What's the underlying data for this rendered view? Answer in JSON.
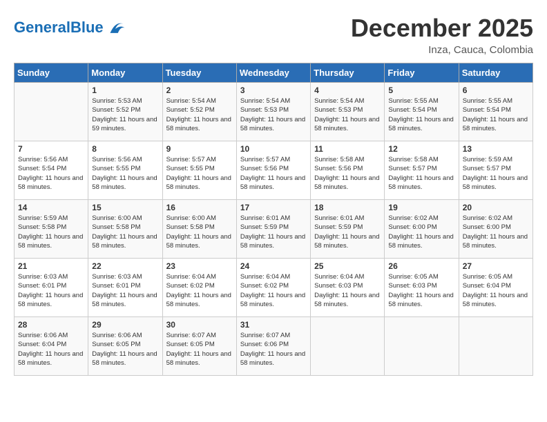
{
  "header": {
    "logo_general": "General",
    "logo_blue": "Blue",
    "title": "December 2025",
    "subtitle": "Inza, Cauca, Colombia"
  },
  "calendar": {
    "days_of_week": [
      "Sunday",
      "Monday",
      "Tuesday",
      "Wednesday",
      "Thursday",
      "Friday",
      "Saturday"
    ],
    "weeks": [
      [
        {
          "day": "",
          "sunrise": "",
          "sunset": "",
          "daylight": ""
        },
        {
          "day": "1",
          "sunrise": "Sunrise: 5:53 AM",
          "sunset": "Sunset: 5:52 PM",
          "daylight": "Daylight: 11 hours and 59 minutes."
        },
        {
          "day": "2",
          "sunrise": "Sunrise: 5:54 AM",
          "sunset": "Sunset: 5:52 PM",
          "daylight": "Daylight: 11 hours and 58 minutes."
        },
        {
          "day": "3",
          "sunrise": "Sunrise: 5:54 AM",
          "sunset": "Sunset: 5:53 PM",
          "daylight": "Daylight: 11 hours and 58 minutes."
        },
        {
          "day": "4",
          "sunrise": "Sunrise: 5:54 AM",
          "sunset": "Sunset: 5:53 PM",
          "daylight": "Daylight: 11 hours and 58 minutes."
        },
        {
          "day": "5",
          "sunrise": "Sunrise: 5:55 AM",
          "sunset": "Sunset: 5:54 PM",
          "daylight": "Daylight: 11 hours and 58 minutes."
        },
        {
          "day": "6",
          "sunrise": "Sunrise: 5:55 AM",
          "sunset": "Sunset: 5:54 PM",
          "daylight": "Daylight: 11 hours and 58 minutes."
        }
      ],
      [
        {
          "day": "7",
          "sunrise": "Sunrise: 5:56 AM",
          "sunset": "Sunset: 5:54 PM",
          "daylight": "Daylight: 11 hours and 58 minutes."
        },
        {
          "day": "8",
          "sunrise": "Sunrise: 5:56 AM",
          "sunset": "Sunset: 5:55 PM",
          "daylight": "Daylight: 11 hours and 58 minutes."
        },
        {
          "day": "9",
          "sunrise": "Sunrise: 5:57 AM",
          "sunset": "Sunset: 5:55 PM",
          "daylight": "Daylight: 11 hours and 58 minutes."
        },
        {
          "day": "10",
          "sunrise": "Sunrise: 5:57 AM",
          "sunset": "Sunset: 5:56 PM",
          "daylight": "Daylight: 11 hours and 58 minutes."
        },
        {
          "day": "11",
          "sunrise": "Sunrise: 5:58 AM",
          "sunset": "Sunset: 5:56 PM",
          "daylight": "Daylight: 11 hours and 58 minutes."
        },
        {
          "day": "12",
          "sunrise": "Sunrise: 5:58 AM",
          "sunset": "Sunset: 5:57 PM",
          "daylight": "Daylight: 11 hours and 58 minutes."
        },
        {
          "day": "13",
          "sunrise": "Sunrise: 5:59 AM",
          "sunset": "Sunset: 5:57 PM",
          "daylight": "Daylight: 11 hours and 58 minutes."
        }
      ],
      [
        {
          "day": "14",
          "sunrise": "Sunrise: 5:59 AM",
          "sunset": "Sunset: 5:58 PM",
          "daylight": "Daylight: 11 hours and 58 minutes."
        },
        {
          "day": "15",
          "sunrise": "Sunrise: 6:00 AM",
          "sunset": "Sunset: 5:58 PM",
          "daylight": "Daylight: 11 hours and 58 minutes."
        },
        {
          "day": "16",
          "sunrise": "Sunrise: 6:00 AM",
          "sunset": "Sunset: 5:58 PM",
          "daylight": "Daylight: 11 hours and 58 minutes."
        },
        {
          "day": "17",
          "sunrise": "Sunrise: 6:01 AM",
          "sunset": "Sunset: 5:59 PM",
          "daylight": "Daylight: 11 hours and 58 minutes."
        },
        {
          "day": "18",
          "sunrise": "Sunrise: 6:01 AM",
          "sunset": "Sunset: 5:59 PM",
          "daylight": "Daylight: 11 hours and 58 minutes."
        },
        {
          "day": "19",
          "sunrise": "Sunrise: 6:02 AM",
          "sunset": "Sunset: 6:00 PM",
          "daylight": "Daylight: 11 hours and 58 minutes."
        },
        {
          "day": "20",
          "sunrise": "Sunrise: 6:02 AM",
          "sunset": "Sunset: 6:00 PM",
          "daylight": "Daylight: 11 hours and 58 minutes."
        }
      ],
      [
        {
          "day": "21",
          "sunrise": "Sunrise: 6:03 AM",
          "sunset": "Sunset: 6:01 PM",
          "daylight": "Daylight: 11 hours and 58 minutes."
        },
        {
          "day": "22",
          "sunrise": "Sunrise: 6:03 AM",
          "sunset": "Sunset: 6:01 PM",
          "daylight": "Daylight: 11 hours and 58 minutes."
        },
        {
          "day": "23",
          "sunrise": "Sunrise: 6:04 AM",
          "sunset": "Sunset: 6:02 PM",
          "daylight": "Daylight: 11 hours and 58 minutes."
        },
        {
          "day": "24",
          "sunrise": "Sunrise: 6:04 AM",
          "sunset": "Sunset: 6:02 PM",
          "daylight": "Daylight: 11 hours and 58 minutes."
        },
        {
          "day": "25",
          "sunrise": "Sunrise: 6:04 AM",
          "sunset": "Sunset: 6:03 PM",
          "daylight": "Daylight: 11 hours and 58 minutes."
        },
        {
          "day": "26",
          "sunrise": "Sunrise: 6:05 AM",
          "sunset": "Sunset: 6:03 PM",
          "daylight": "Daylight: 11 hours and 58 minutes."
        },
        {
          "day": "27",
          "sunrise": "Sunrise: 6:05 AM",
          "sunset": "Sunset: 6:04 PM",
          "daylight": "Daylight: 11 hours and 58 minutes."
        }
      ],
      [
        {
          "day": "28",
          "sunrise": "Sunrise: 6:06 AM",
          "sunset": "Sunset: 6:04 PM",
          "daylight": "Daylight: 11 hours and 58 minutes."
        },
        {
          "day": "29",
          "sunrise": "Sunrise: 6:06 AM",
          "sunset": "Sunset: 6:05 PM",
          "daylight": "Daylight: 11 hours and 58 minutes."
        },
        {
          "day": "30",
          "sunrise": "Sunrise: 6:07 AM",
          "sunset": "Sunset: 6:05 PM",
          "daylight": "Daylight: 11 hours and 58 minutes."
        },
        {
          "day": "31",
          "sunrise": "Sunrise: 6:07 AM",
          "sunset": "Sunset: 6:06 PM",
          "daylight": "Daylight: 11 hours and 58 minutes."
        },
        {
          "day": "",
          "sunrise": "",
          "sunset": "",
          "daylight": ""
        },
        {
          "day": "",
          "sunrise": "",
          "sunset": "",
          "daylight": ""
        },
        {
          "day": "",
          "sunrise": "",
          "sunset": "",
          "daylight": ""
        }
      ]
    ]
  }
}
